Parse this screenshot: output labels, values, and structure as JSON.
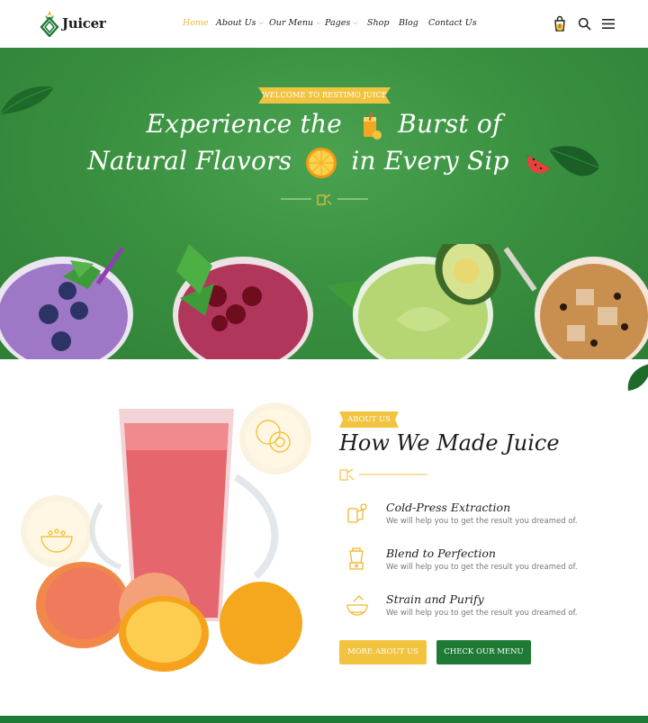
{
  "header": {
    "logo_text": "Juicer",
    "nav": [
      {
        "label": "Home",
        "active": true,
        "dropdown": false
      },
      {
        "label": "About Us",
        "active": false,
        "dropdown": true
      },
      {
        "label": "Our Menu",
        "active": false,
        "dropdown": true
      },
      {
        "label": "Pages",
        "active": false,
        "dropdown": true
      },
      {
        "label": "Shop",
        "active": false,
        "dropdown": false
      },
      {
        "label": "Blog",
        "active": false,
        "dropdown": false
      },
      {
        "label": "Contact Us",
        "active": false,
        "dropdown": false
      }
    ],
    "cart_count": "0",
    "icons": [
      "cart-icon",
      "search-icon",
      "menu-icon"
    ]
  },
  "hero": {
    "badge": "WELCOME TO RESTIMO JUICE",
    "line1_a": "Experience the",
    "line1_b": "Burst of",
    "line2_a": "Natural Flavors",
    "line2_b": "in Every Sip"
  },
  "about": {
    "tag": "ABOUT US",
    "title": "How We Made Juice",
    "features": [
      {
        "title": "Cold-Press Extraction",
        "desc": "We will help you to get the result you dreamed of.",
        "icon": "juicer-icon"
      },
      {
        "title": "Blend to Perfection",
        "desc": "We will help you to get the result you dreamed of.",
        "icon": "blender-icon"
      },
      {
        "title": "Strain and Purify",
        "desc": "We will help you to get the result you dreamed of.",
        "icon": "strainer-icon"
      }
    ],
    "btn_more": "MORE ABOUT US",
    "btn_menu": "CHECK OUR MENU"
  },
  "colors": {
    "brand_green": "#1f7a35",
    "accent_yellow": "#f2c33f",
    "hero_green": "#3a9140",
    "active_nav": "#f2b632"
  }
}
